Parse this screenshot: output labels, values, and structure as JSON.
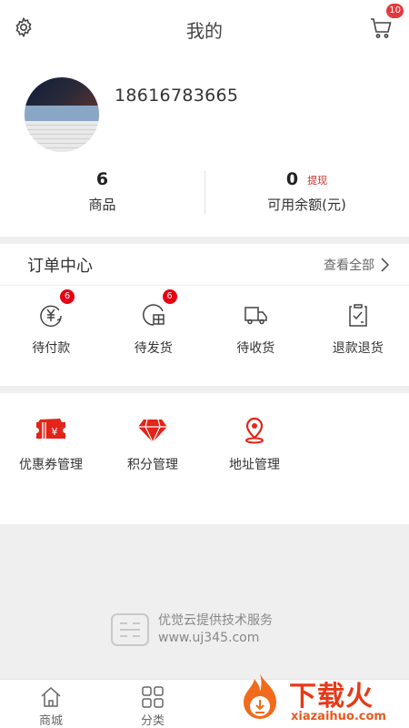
{
  "header": {
    "title": "我的",
    "cart_badge": "10"
  },
  "profile": {
    "phone": "18616783665"
  },
  "stats": {
    "goods_value": "6",
    "goods_label": "商品",
    "balance_value": "0",
    "balance_label": "可用余额(元)",
    "withdraw_label": "提现"
  },
  "orders": {
    "title": "订单中心",
    "see_all": "查看全部",
    "items": [
      {
        "label": "待付款",
        "badge": "6",
        "icon": "yuan-pay-icon"
      },
      {
        "label": "待发货",
        "badge": "6",
        "icon": "package-icon"
      },
      {
        "label": "待收货",
        "badge": "",
        "icon": "truck-icon"
      },
      {
        "label": "退款退货",
        "badge": "",
        "icon": "refund-doc-icon"
      }
    ]
  },
  "tools": [
    {
      "label": "优惠券管理",
      "icon": "coupon-icon"
    },
    {
      "label": "积分管理",
      "icon": "diamond-icon"
    },
    {
      "label": "地址管理",
      "icon": "location-pin-icon"
    }
  ],
  "powered": {
    "line1": "优觉云提供技术服务",
    "line2": "www.uj345.com"
  },
  "tabbar": [
    {
      "label": "商城",
      "icon": "home-icon"
    },
    {
      "label": "分类",
      "icon": "grid-icon"
    }
  ],
  "watermark": {
    "big": "下载火",
    "small": "xiazaihuo.com"
  },
  "colors": {
    "accent": "#e4393c",
    "badge": "#e60012",
    "watermark": "#e63a18"
  }
}
